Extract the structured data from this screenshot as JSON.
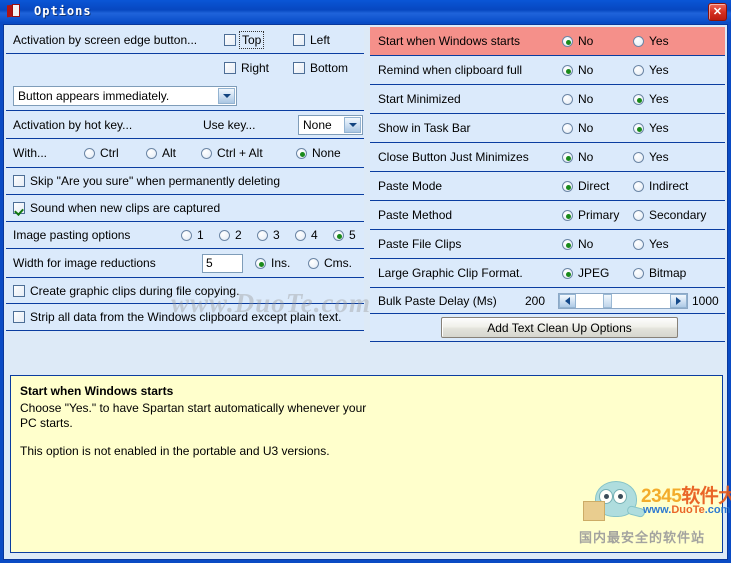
{
  "window": {
    "title": "Options",
    "icon": "book-icon",
    "close_label": "✕"
  },
  "left_panel": {
    "screen_edge": {
      "label": "Activation by screen edge button...",
      "checkboxes": [
        {
          "label": "Top",
          "checked": false,
          "focused": true
        },
        {
          "label": "Left",
          "checked": false,
          "focused": false
        },
        {
          "label": "Right",
          "checked": false,
          "focused": false
        },
        {
          "label": "Bottom",
          "checked": false,
          "focused": false
        }
      ],
      "combo_value": "Button appears immediately."
    },
    "hotkey": {
      "label": "Activation by hot key...",
      "use_key_label": "Use key...",
      "use_key_value": "None",
      "with_label": "With...",
      "options": [
        {
          "label": "Ctrl",
          "selected": false
        },
        {
          "label": "Alt",
          "selected": false
        },
        {
          "label": "Ctrl + Alt",
          "selected": false
        },
        {
          "label": "None",
          "selected": true
        }
      ]
    },
    "skip_confirm": {
      "label": "Skip \"Are you sure\" when permanently deleting",
      "checked": false
    },
    "sound_clips": {
      "label": "Sound when new clips are captured",
      "checked": true
    },
    "image_pasting": {
      "label": "Image pasting options",
      "options": [
        {
          "label": "1",
          "selected": false
        },
        {
          "label": "2",
          "selected": false
        },
        {
          "label": "3",
          "selected": false
        },
        {
          "label": "4",
          "selected": false
        },
        {
          "label": "5",
          "selected": true
        }
      ]
    },
    "width_reductions": {
      "label": "Width for image reductions",
      "value": "5",
      "units": [
        {
          "label": "Ins.",
          "selected": true
        },
        {
          "label": "Cms.",
          "selected": false
        }
      ]
    },
    "graphic_clips": {
      "label": "Create graphic clips during file copying.",
      "checked": false
    },
    "strip_data": {
      "label": "Strip all data from the Windows clipboard except plain text.",
      "checked": false
    }
  },
  "right_panel": {
    "rows": [
      {
        "label": "Start when Windows starts",
        "highlighted": true,
        "options": [
          {
            "label": "No",
            "selected": true
          },
          {
            "label": "Yes",
            "selected": false
          }
        ]
      },
      {
        "label": "Remind when clipboard full",
        "highlighted": false,
        "options": [
          {
            "label": "No",
            "selected": true
          },
          {
            "label": "Yes",
            "selected": false
          }
        ]
      },
      {
        "label": "Start Minimized",
        "highlighted": false,
        "options": [
          {
            "label": "No",
            "selected": false
          },
          {
            "label": "Yes",
            "selected": true
          }
        ]
      },
      {
        "label": "Show in Task Bar",
        "highlighted": false,
        "options": [
          {
            "label": "No",
            "selected": false
          },
          {
            "label": "Yes",
            "selected": true
          }
        ]
      },
      {
        "label": "Close Button Just Minimizes",
        "highlighted": false,
        "options": [
          {
            "label": "No",
            "selected": true
          },
          {
            "label": "Yes",
            "selected": false
          }
        ]
      },
      {
        "label": "Paste Mode",
        "highlighted": false,
        "options": [
          {
            "label": "Direct",
            "selected": true
          },
          {
            "label": "Indirect",
            "selected": false
          }
        ]
      },
      {
        "label": "Paste Method",
        "highlighted": false,
        "options": [
          {
            "label": "Primary",
            "selected": true
          },
          {
            "label": "Secondary",
            "selected": false
          }
        ]
      },
      {
        "label": "Paste File Clips",
        "highlighted": false,
        "options": [
          {
            "label": "No",
            "selected": true
          },
          {
            "label": "Yes",
            "selected": false
          }
        ]
      },
      {
        "label": "Large Graphic Clip Format.",
        "highlighted": false,
        "options": [
          {
            "label": "JPEG",
            "selected": true
          },
          {
            "label": "Bitmap",
            "selected": false
          }
        ]
      }
    ],
    "bulk_delay": {
      "label": "Bulk Paste Delay (Ms)",
      "min_label": "200",
      "max_label": "1000",
      "value_percent": 33
    },
    "cleanup_button": "Add Text Clean Up Options"
  },
  "info_pane": {
    "heading": "Start when Windows starts",
    "paragraph1": "Choose \"Yes.\" to have Spartan start automatically whenever your PC starts.",
    "paragraph2": "This option is not enabled in the portable and U3 versions."
  },
  "watermarks": {
    "center": "www.DuoTe.com",
    "logo_brand_num": "2345",
    "logo_brand_cn": "软件大全",
    "logo_site_a": "www.",
    "logo_site_b": "DuoTe",
    "logo_site_c": ".com",
    "logo_tagline": "国内最安全的软件站"
  },
  "colors": {
    "titlebar": "#0a4bc4",
    "panel_bg": "#dbeafb",
    "grid_line": "#0a3da0",
    "highlight_row": "#f5908a",
    "info_bg": "#ffffcc",
    "radio_dot": "#1a8a1a"
  }
}
